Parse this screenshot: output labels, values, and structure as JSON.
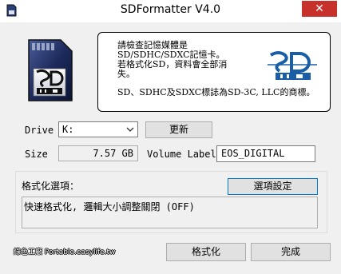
{
  "window": {
    "title": "SDFormatter V4.0",
    "close_symbol": "✕",
    "app_icon": "sd-formatter-icon"
  },
  "info": {
    "text1": "請檢查記憶媒體是\nSD/SDHC/SDXC記憶卡。\n若格式化SD，資料會全部消\n失。",
    "text2": "SD、SDHC及SDXC標誌為SD-3C, LLC的商標。",
    "logo": "sdhc-logo"
  },
  "drive": {
    "label": "Drive",
    "value": "K:",
    "refresh_label": "更新"
  },
  "size": {
    "label": "Size",
    "value": "7.57 GB"
  },
  "volume": {
    "label": "Volume Label",
    "value": "EOS_DIGITAL"
  },
  "options": {
    "group_label": "格式化選項：",
    "settings_button": "選項設定",
    "current": "快速格式化, 邏輯大小調整關閉 (OFF)"
  },
  "footer": {
    "watermark": "綠色工廠 Portable.easylife.tw",
    "format_button": "格式化",
    "finish_button": "完成"
  },
  "colors": {
    "close_button": "#c7312b",
    "focus_border": "#0078d7",
    "logo_blue": "#1a5ea8"
  }
}
